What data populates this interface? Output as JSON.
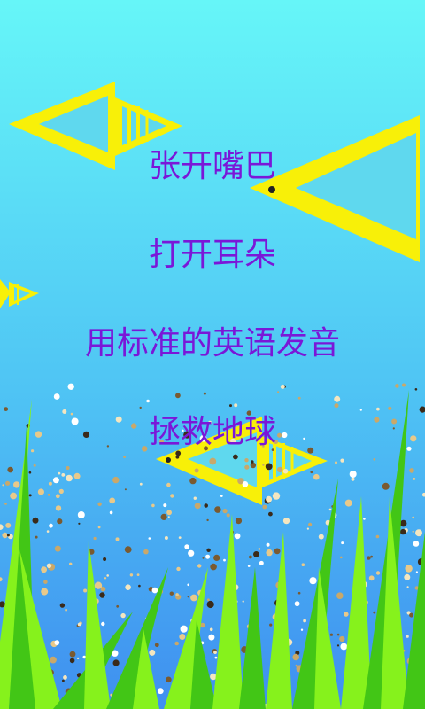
{
  "screen": {
    "lines": [
      "张开嘴巴",
      "打开耳朵",
      "用标准的英语发音",
      "拯救地球"
    ]
  },
  "colors": {
    "text": "#7a17d8",
    "sky_top": "#66f6f8",
    "sky_bottom": "#3f93f2",
    "fish_yellow": "#f8f008",
    "fish_body": "#5fd8ee",
    "grass_light": "#86f21c",
    "grass_dark": "#42c616"
  },
  "icons": [
    "fish-icon",
    "seaweed",
    "sand-dots"
  ]
}
